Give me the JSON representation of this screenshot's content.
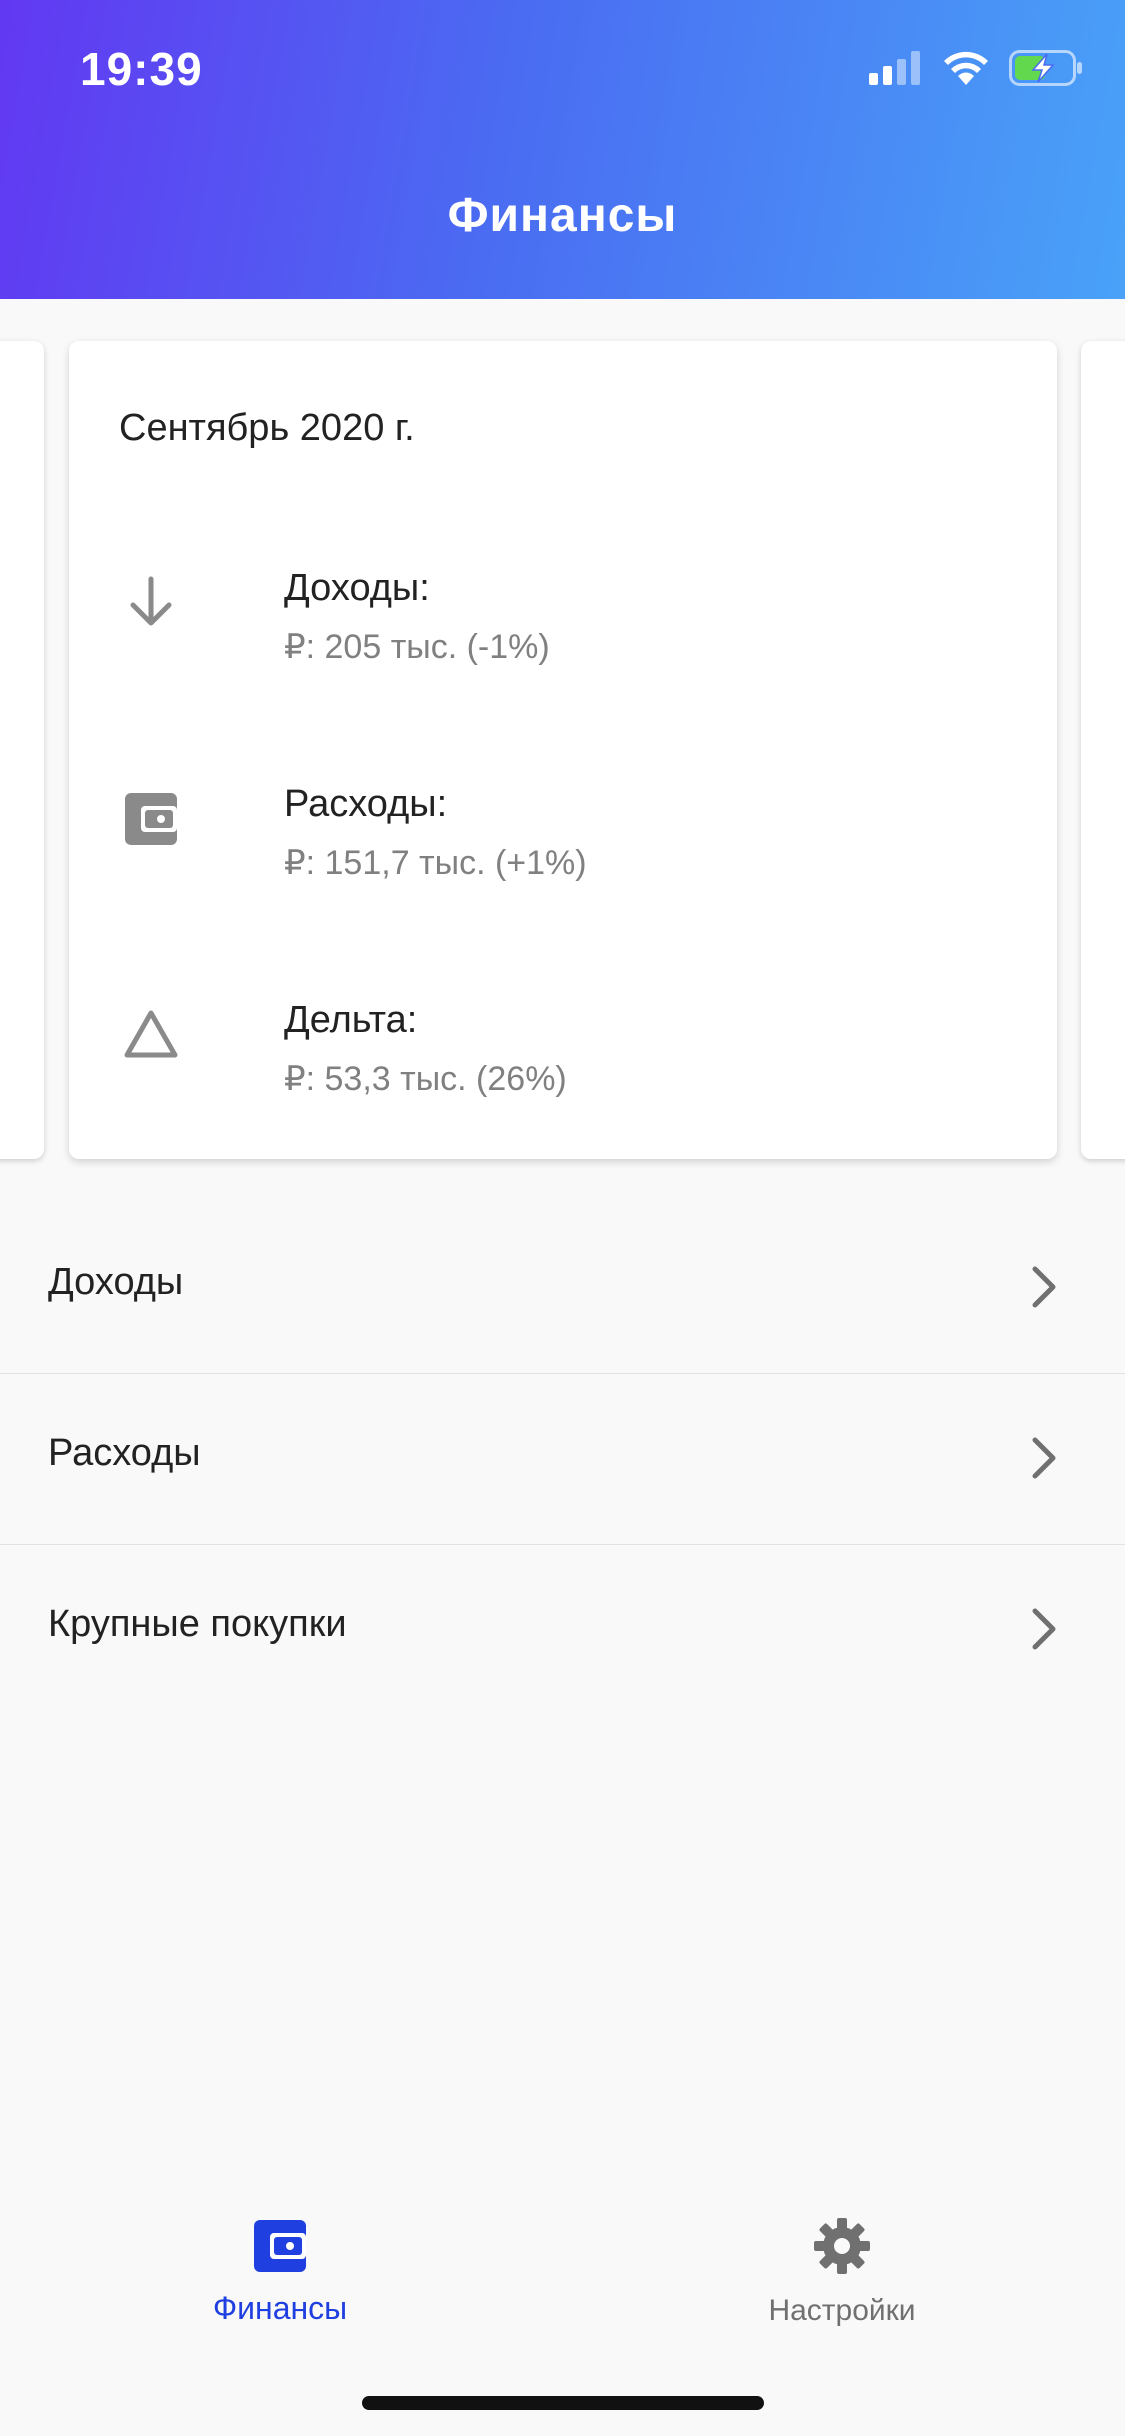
{
  "status_bar": {
    "time": "19:39"
  },
  "header": {
    "title": "Финансы"
  },
  "summary_card": {
    "month": "Сентябрь 2020 г.",
    "stats": [
      {
        "icon": "arrow-down-icon",
        "label": "Доходы:",
        "value": "₽: 205 тыс. (-1%)"
      },
      {
        "icon": "wallet-icon",
        "label": "Расходы:",
        "value": "₽: 151,7 тыс. (+1%)"
      },
      {
        "icon": "delta-triangle-icon",
        "label": "Дельта:",
        "value": "₽: 53,3 тыс. (26%)"
      }
    ]
  },
  "menu": {
    "items": [
      {
        "label": "Доходы"
      },
      {
        "label": "Расходы"
      },
      {
        "label": "Крупные покупки"
      }
    ]
  },
  "tabbar": {
    "tabs": [
      {
        "label": "Финансы",
        "icon": "wallet-icon",
        "active": true
      },
      {
        "label": "Настройки",
        "icon": "gear-icon",
        "active": false
      }
    ]
  },
  "colors": {
    "header_gradient_start": "#6238f2",
    "header_gradient_end": "#49a2f8",
    "active_tab": "#1f3fe0",
    "inactive_tab": "#707070",
    "icon_gray": "#8a8a8a",
    "battery_green": "#62d84e"
  }
}
